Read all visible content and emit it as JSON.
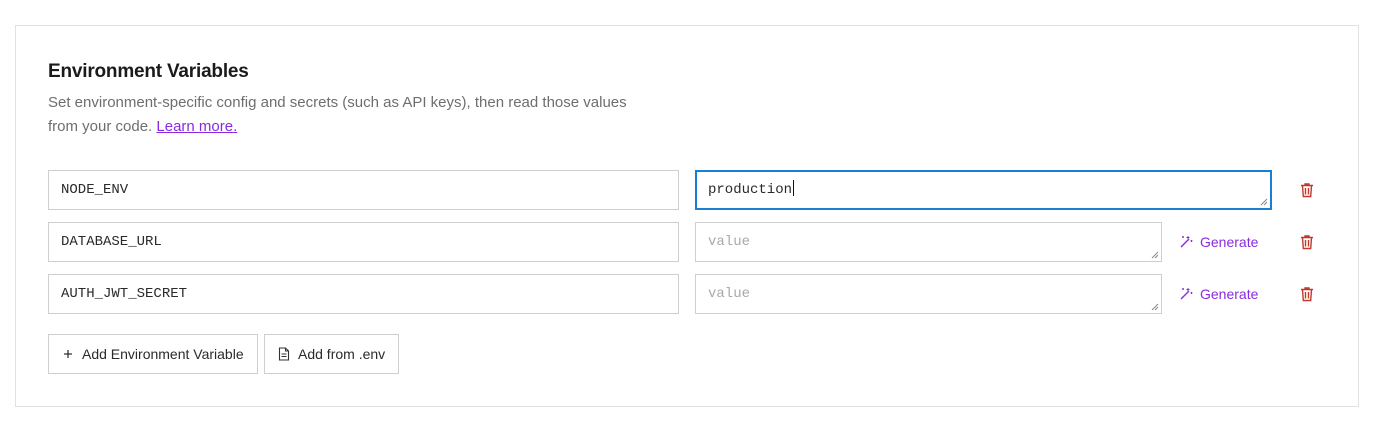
{
  "section": {
    "title": "Environment Variables",
    "description": "Set environment-specific config and secrets (such as API keys), then read those values from your code.",
    "learn_more": "Learn more."
  },
  "env_vars": [
    {
      "key": "NODE_ENV",
      "value": "production",
      "placeholder": "value",
      "focused": true,
      "show_generate": false
    },
    {
      "key": "DATABASE_URL",
      "value": "",
      "placeholder": "value",
      "focused": false,
      "show_generate": true
    },
    {
      "key": "AUTH_JWT_SECRET",
      "value": "",
      "placeholder": "value",
      "focused": false,
      "show_generate": true
    }
  ],
  "generate_label": "Generate",
  "buttons": {
    "add_variable": "Add Environment Variable",
    "add_from_env": "Add from .env"
  },
  "icons": {
    "generate": "magic-wand-icon",
    "delete": "trash-icon",
    "add": "plus-icon",
    "file": "file-icon"
  },
  "colors": {
    "accent": "#8a2be2",
    "focus_border": "#1a7fd4",
    "delete": "#c0392b"
  }
}
